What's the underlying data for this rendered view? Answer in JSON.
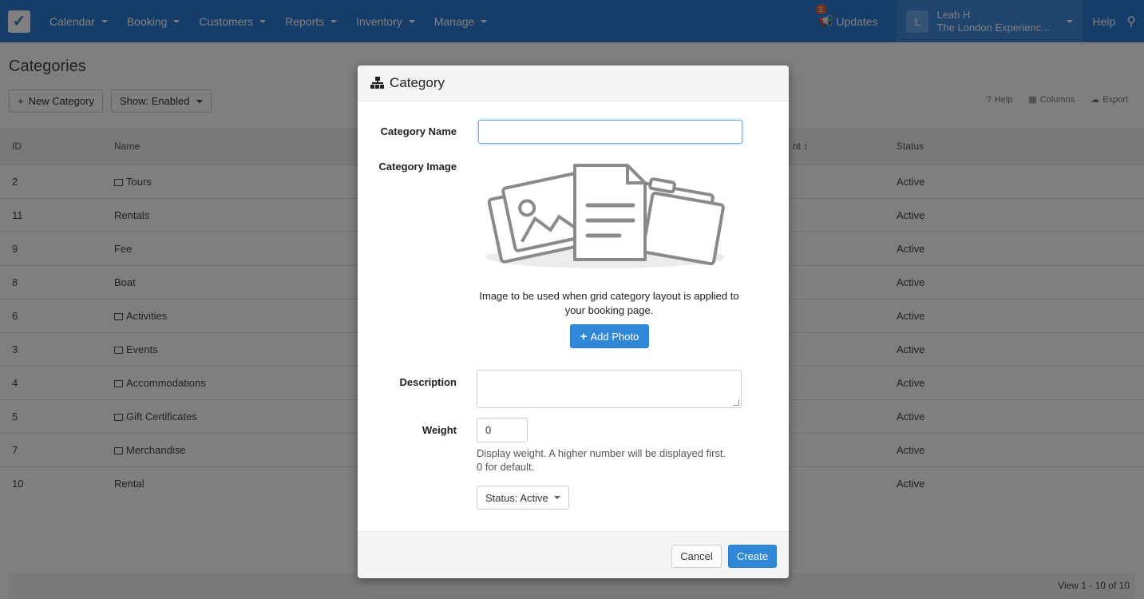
{
  "nav": {
    "items": [
      {
        "label": "Calendar"
      },
      {
        "label": "Booking"
      },
      {
        "label": "Customers"
      },
      {
        "label": "Reports"
      },
      {
        "label": "Inventory"
      },
      {
        "label": "Manage"
      }
    ],
    "updates_label": "Updates",
    "updates_badge": "1",
    "user_initial": "L",
    "user_name": "Leah H",
    "user_company": "The London Experienc...",
    "help_label": "Help"
  },
  "page": {
    "title": "Categories",
    "new_category_label": "New Category",
    "show_filter_label": "Show: Enabled",
    "toolbar_help": "Help",
    "toolbar_columns": "Columns",
    "toolbar_export": "Export",
    "columns": [
      "ID",
      "Name",
      "nt ↕",
      "Status"
    ],
    "rows": [
      {
        "id": "2",
        "name": "Tours",
        "has_image": true,
        "status": "Active"
      },
      {
        "id": "11",
        "name": "Rentals",
        "has_image": false,
        "status": "Active"
      },
      {
        "id": "9",
        "name": "Fee",
        "has_image": false,
        "status": "Active"
      },
      {
        "id": "8",
        "name": "Boat",
        "has_image": false,
        "status": "Active"
      },
      {
        "id": "6",
        "name": "Activities",
        "has_image": true,
        "status": "Active"
      },
      {
        "id": "3",
        "name": "Events",
        "has_image": true,
        "status": "Active"
      },
      {
        "id": "4",
        "name": "Accommodations",
        "has_image": true,
        "status": "Active"
      },
      {
        "id": "5",
        "name": "Gift Certificates",
        "has_image": true,
        "status": "Active"
      },
      {
        "id": "7",
        "name": "Merchandise",
        "has_image": true,
        "status": "Active"
      },
      {
        "id": "10",
        "name": "Rental",
        "has_image": false,
        "status": "Active"
      }
    ],
    "pagination_info": "View 1 - 10 of 10"
  },
  "modal": {
    "title": "Category",
    "category_name_label": "Category Name",
    "category_name_value": "",
    "category_image_label": "Category Image",
    "image_help": "Image to be used when grid category layout is applied to your booking page.",
    "add_photo_label": "Add Photo",
    "description_label": "Description",
    "description_value": "",
    "weight_label": "Weight",
    "weight_value": "0",
    "weight_help_line1": "Display weight. A higher number will be displayed first.",
    "weight_help_line2": "0 for default.",
    "status_label": "Status: Active",
    "cancel_label": "Cancel",
    "create_label": "Create"
  },
  "colors": {
    "nav_bg": "#2c7bd3",
    "primary_button": "#2f87d8",
    "overlay": "rgba(0,0,0,0.5)"
  }
}
